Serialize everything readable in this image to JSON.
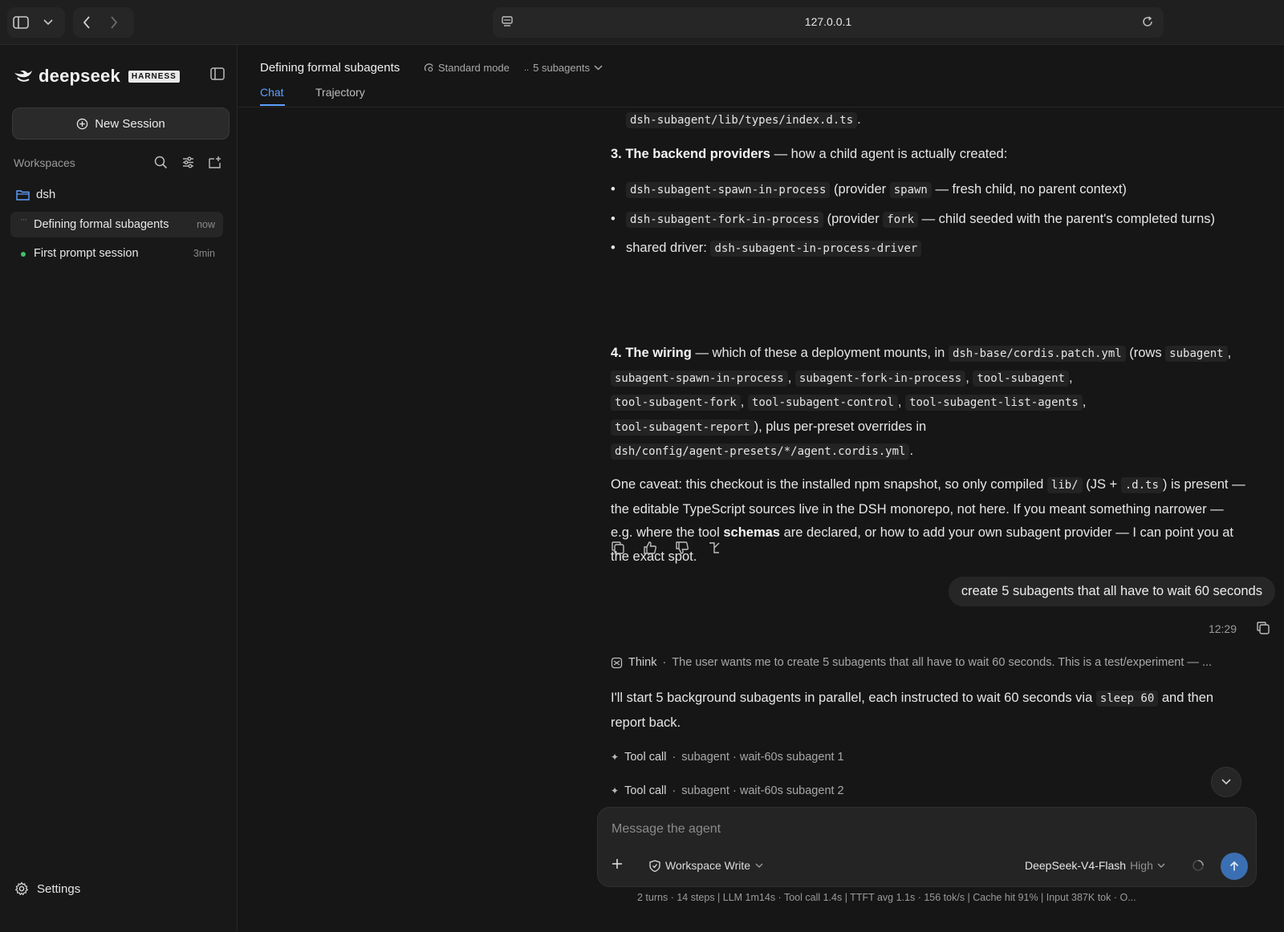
{
  "browser": {
    "url": "127.0.0.1"
  },
  "sidebar": {
    "brand_name": "deepseek",
    "brand_badge": "HARNESS",
    "new_session_label": "New Session",
    "workspaces_label": "Workspaces",
    "workspace": {
      "name": "dsh"
    },
    "sessions": [
      {
        "title": "Defining formal subagents",
        "time": "now",
        "active": true
      },
      {
        "title": "First prompt session",
        "time": "3min",
        "active": false
      }
    ],
    "settings_label": "Settings"
  },
  "header": {
    "title": "Defining formal subagents",
    "mode": "Standard mode",
    "subagents": "5 subagents",
    "tabs": [
      {
        "label": "Chat",
        "active": true
      },
      {
        "label": "Trajectory",
        "active": false
      }
    ]
  },
  "chat": {
    "top_code": "dsh-subagent/lib/types/index.d.ts",
    "top_tail": ".",
    "s3": {
      "head": "3. The backend providers",
      "tail": " — how a child agent is actually created:",
      "b1_code": "dsh-subagent-spawn-in-process",
      "b1_a": " (provider ",
      "b1_code2": "spawn",
      "b1_b": " — fresh child, no parent context)",
      "b2_code": "dsh-subagent-fork-in-process",
      "b2_a": " (provider ",
      "b2_code2": "fork",
      "b2_b": " — child seeded with the parent's completed turns)",
      "b3_a": "shared driver: ",
      "b3_code": "dsh-subagent-in-process-driver"
    },
    "s4": {
      "head": "4. The wiring",
      "a": " — which of these a deployment mounts, in ",
      "c1": "dsh-base/cordis.patch.yml",
      "b": " (rows ",
      "c2": "subagent",
      "c3": "subagent-spawn-in-process",
      "c4": "subagent-fork-in-process",
      "c5": "tool-subagent",
      "c6": "tool-subagent-fork",
      "c7": "tool-subagent-control",
      "c8": "tool-subagent-list-agents",
      "c9": "tool-subagent-report",
      "c": "), plus per-preset overrides in",
      "c10": "dsh/config/agent-presets/*/agent.cordis.yml",
      "d": "."
    },
    "caveat": {
      "a": "One caveat: this checkout is the installed npm snapshot, so only compiled ",
      "c1": "lib/",
      "b": " (JS + ",
      "c2": ".d.ts",
      "c": ") is present — the editable TypeScript sources live in the DSH monorepo, not here. If you meant something narrower — e.g. where the tool ",
      "bold": "schemas",
      "d": " are declared, or how to add your own subagent provider — I can point you at the exact spot."
    },
    "user_message": "create 5 subagents that all have to wait 60 seconds",
    "user_time": "12:29",
    "think_label": "Think",
    "think_text": "The user wants me to create 5 subagents that all have to wait 60 seconds. This is a test/experiment — ...",
    "reply_a": "I'll start 5 background subagents in parallel, each instructed to wait 60 seconds via ",
    "reply_code": "sleep 60",
    "reply_b": " and then report back.",
    "tool_calls": [
      {
        "label": "Tool call",
        "detail": "subagent · wait-60s subagent 1"
      },
      {
        "label": "Tool call",
        "detail": "subagent · wait-60s subagent 2"
      }
    ]
  },
  "composer": {
    "placeholder": "Message the agent",
    "permission": "Workspace Write",
    "model": "DeepSeek-V4-Flash",
    "level": "High"
  },
  "status": "2 turns · 14 steps   |   LLM 1m14s · Tool call 1.4s   |   TTFT avg 1.1s · 156 tok/s   |   Cache hit 91%   |   Input 387K tok · O..."
}
